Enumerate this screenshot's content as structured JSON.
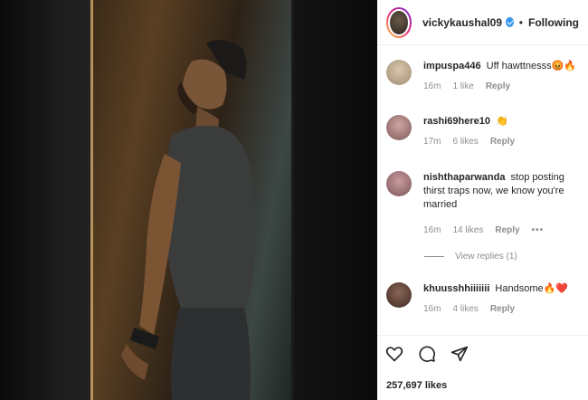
{
  "post": {
    "author": "vickykaushal09",
    "verified": true,
    "follow_status": "Following",
    "separator": "•",
    "likes": "257,697 likes"
  },
  "comments": [
    {
      "user": "impuspa446",
      "text": "Uff hawttnesss",
      "emoji": "😡🔥",
      "time": "16m",
      "likes": "1 like",
      "reply": "Reply",
      "avatar_color": "#c8b79e"
    },
    {
      "user": "rashi69here10",
      "text": "",
      "emoji": "👏",
      "time": "17m",
      "likes": "6 likes",
      "reply": "Reply",
      "avatar_color": "#b08686"
    },
    {
      "user": "nishthaparwanda",
      "text": "stop posting thirst traps now, we know you're married",
      "emoji": "",
      "time": "16m",
      "likes": "14 likes",
      "reply": "Reply",
      "more": "•••",
      "avatar_color": "#a87a7e"
    },
    {
      "user": "khuusshhiiiiiii",
      "text": "Handsome",
      "emoji": "🔥❤️",
      "time": "16m",
      "likes": "4 likes",
      "reply": "Reply",
      "avatar_color": "#6a4c3e"
    }
  ],
  "view_replies": "View replies (1)",
  "icons": {
    "like": "heart-icon",
    "comment": "comment-icon",
    "share": "share-icon"
  },
  "colors": {
    "verified": "#3897f0",
    "text": "#262626",
    "meta": "#8e8e8e"
  }
}
